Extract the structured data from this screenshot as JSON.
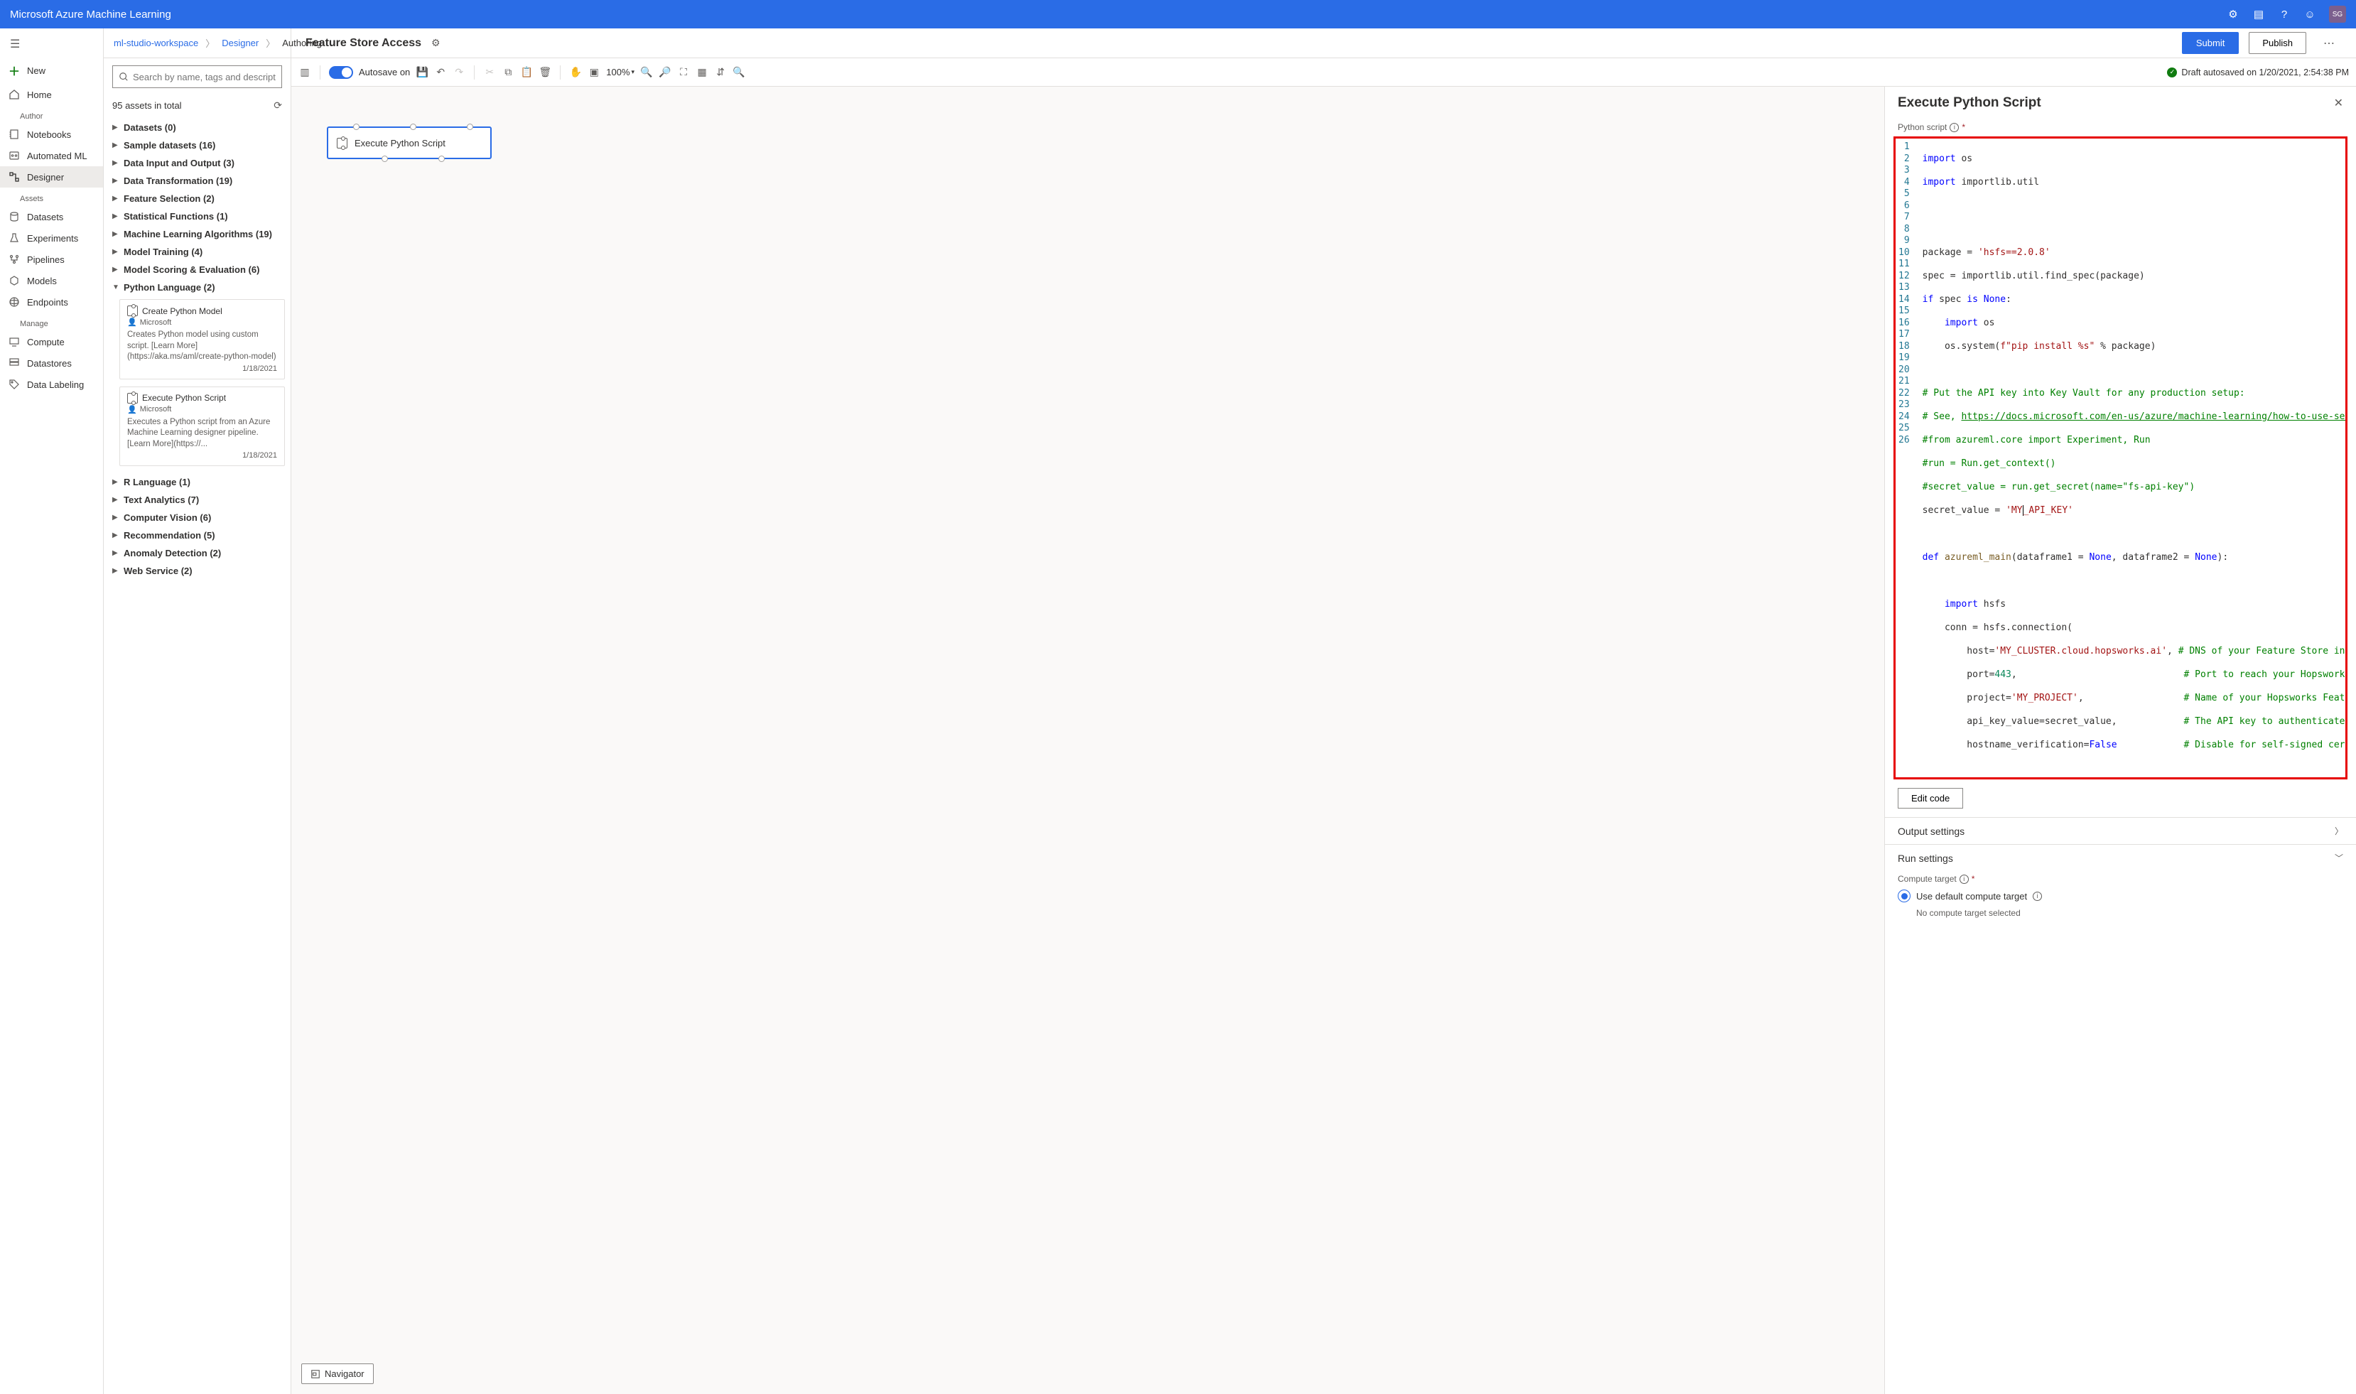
{
  "topBar": {
    "title": "Microsoft Azure Machine Learning",
    "avatar": "SG"
  },
  "leftRail": {
    "new": "New",
    "home": "Home",
    "sections": {
      "author": "Author",
      "assets": "Assets",
      "manage": "Manage"
    },
    "author_items": {
      "notebooks": "Notebooks",
      "automl": "Automated ML",
      "designer": "Designer"
    },
    "asset_items": {
      "datasets": "Datasets",
      "experiments": "Experiments",
      "pipelines": "Pipelines",
      "models": "Models",
      "endpoints": "Endpoints"
    },
    "manage_items": {
      "compute": "Compute",
      "datastores": "Datastores",
      "labeling": "Data Labeling"
    }
  },
  "breadcrumb": {
    "workspace": "ml-studio-workspace",
    "designer": "Designer",
    "authoring": "Authoring"
  },
  "search": {
    "placeholder": "Search by name, tags and description"
  },
  "assetsTotal": "95 assets in total",
  "tree": {
    "datasets": "Datasets (0)",
    "sample": "Sample datasets (16)",
    "dataio": "Data Input and Output (3)",
    "transform": "Data Transformation (19)",
    "feature": "Feature Selection (2)",
    "stat": "Statistical Functions (1)",
    "mla": "Machine Learning Algorithms (19)",
    "training": "Model Training (4)",
    "scoring": "Model Scoring & Evaluation (6)",
    "python": "Python Language (2)",
    "r": "R Language (1)",
    "text": "Text Analytics (7)",
    "cv": "Computer Vision (6)",
    "rec": "Recommendation (5)",
    "anomaly": "Anomaly Detection (2)",
    "web": "Web Service (2)"
  },
  "modules": {
    "cpm": {
      "title": "Create Python Model",
      "publisher": "Microsoft",
      "desc": "Creates Python model using custom script. [Learn More](https://aka.ms/aml/create-python-model)",
      "date": "1/18/2021"
    },
    "eps": {
      "title": "Execute Python Script",
      "publisher": "Microsoft",
      "desc": "Executes a Python script from an Azure Machine Learning designer pipeline. [Learn More](https://...",
      "date": "1/18/2021"
    }
  },
  "header": {
    "pipelineName": "Feature Store Access",
    "submit": "Submit",
    "publish": "Publish"
  },
  "toolbar": {
    "autosave": "Autosave on",
    "zoom": "100%",
    "draft": "Draft autosaved on 1/20/2021, 2:54:38 PM"
  },
  "canvas": {
    "node1": "Execute Python Script",
    "navigator": "Navigator"
  },
  "props": {
    "title": "Execute Python Script",
    "scriptLabel": "Python script",
    "editCode": "Edit code",
    "outputSettings": "Output settings",
    "runSettings": "Run settings",
    "computeTarget": "Compute target",
    "useDefault": "Use default compute target",
    "noCompute": "No compute target selected"
  },
  "code": {
    "l1a": "import",
    "l1b": " os",
    "l2a": "import",
    "l2b": " importlib.util",
    "l5a": "package = ",
    "l5b": "'hsfs==2.0.8'",
    "l6": "spec = importlib.util.find_spec(package)",
    "l7a": "if",
    "l7b": " spec ",
    "l7c": "is",
    "l7d": " None",
    "l8a": "import",
    "l8b": " os",
    "l9a": "    os.system(",
    "l9b": "f\"pip install %s\"",
    "l9c": " % package)",
    "l11": "# Put the API key into Key Vault for any production setup:",
    "l12a": "# See, ",
    "l12b": "https://docs.microsoft.com/en-us/azure/machine-learning/how-to-use-secrets",
    "l13": "#from azureml.core import Experiment, Run",
    "l14": "#run = Run.get_context()",
    "l15": "#secret_value = run.get_secret(name=\"fs-api-key\")",
    "l16a": "secret_value = ",
    "l16b": "'MY",
    "l16c": "_API_KEY'",
    "l18a": "def",
    "l18b": " azureml_main",
    "l18c": "(dataframe1 = ",
    "l18d": "None",
    "l18e": ", dataframe2 = ",
    "l18f": "None",
    "l18g": "):",
    "l20a": "import",
    "l20b": " hsfs",
    "l21": "    conn = hsfs.connection(",
    "l22a": "        host=",
    "l22b": "'MY_CLUSTER.cloud.hopsworks.ai'",
    "l22c": ", ",
    "l22d": "# DNS of your Feature Store instanc",
    "l23a": "        port=",
    "l23b": "443",
    "l23c": ",                              ",
    "l23d": "# Port to reach your Hopsworks instan",
    "l24a": "        project=",
    "l24b": "'MY_PROJECT'",
    "l24c": ",                  ",
    "l24d": "# Name of your Hopsworks Feature Stor",
    "l25a": "        api_key_value=secret_value,            ",
    "l25b": "# The API key to authenticate wit",
    "l26a": "        hostname_verification=",
    "l26b": "False",
    "l26c": "            ",
    "l26d": "# Disable for self-signed certificat"
  }
}
